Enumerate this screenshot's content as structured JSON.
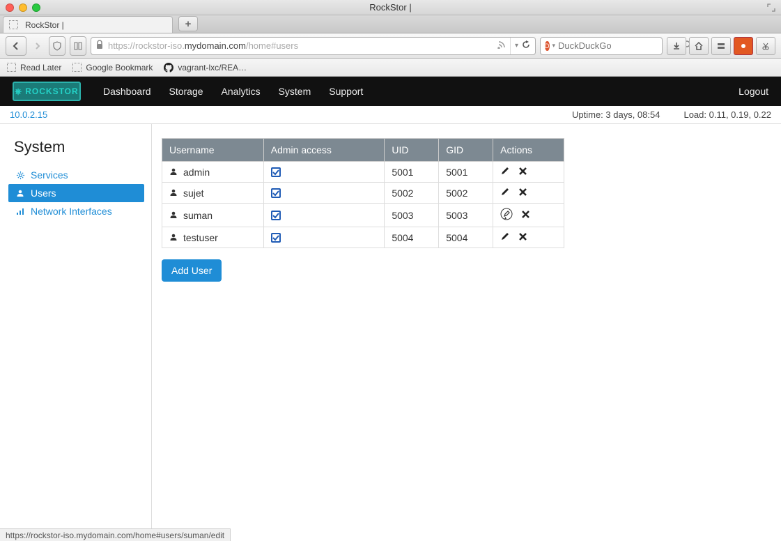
{
  "window": {
    "title": "RockStor |"
  },
  "tabs": [
    {
      "label": "RockStor |"
    }
  ],
  "urlbar": {
    "scheme": "https://",
    "sub": "rockstor-iso.",
    "domain": "mydomain.com",
    "path": "/home#users"
  },
  "search": {
    "placeholder": "DuckDuckGo"
  },
  "bookmarks": [
    {
      "label": "Read Later"
    },
    {
      "label": "Google Bookmark"
    },
    {
      "label": "vagrant-lxc/REA…"
    }
  ],
  "app_nav": {
    "items": [
      "Dashboard",
      "Storage",
      "Analytics",
      "System",
      "Support"
    ],
    "logout": "Logout"
  },
  "status": {
    "ip": "10.0.2.15",
    "uptime": "Uptime: 3 days, 08:54",
    "load": "Load: 0.11, 0.19, 0.22"
  },
  "sidebar": {
    "heading": "System",
    "items": [
      {
        "label": "Services"
      },
      {
        "label": "Users"
      },
      {
        "label": "Network Interfaces"
      }
    ]
  },
  "table": {
    "headers": {
      "username": "Username",
      "admin": "Admin access",
      "uid": "UID",
      "gid": "GID",
      "actions": "Actions"
    },
    "rows": [
      {
        "username": "admin",
        "admin": true,
        "uid": "5001",
        "gid": "5001"
      },
      {
        "username": "sujet",
        "admin": true,
        "uid": "5002",
        "gid": "5002"
      },
      {
        "username": "suman",
        "admin": true,
        "uid": "5003",
        "gid": "5003"
      },
      {
        "username": "testuser",
        "admin": true,
        "uid": "5004",
        "gid": "5004"
      }
    ]
  },
  "buttons": {
    "add_user": "Add User"
  },
  "footer_url": "https://rockstor-iso.mydomain.com/home#users/suman/edit"
}
